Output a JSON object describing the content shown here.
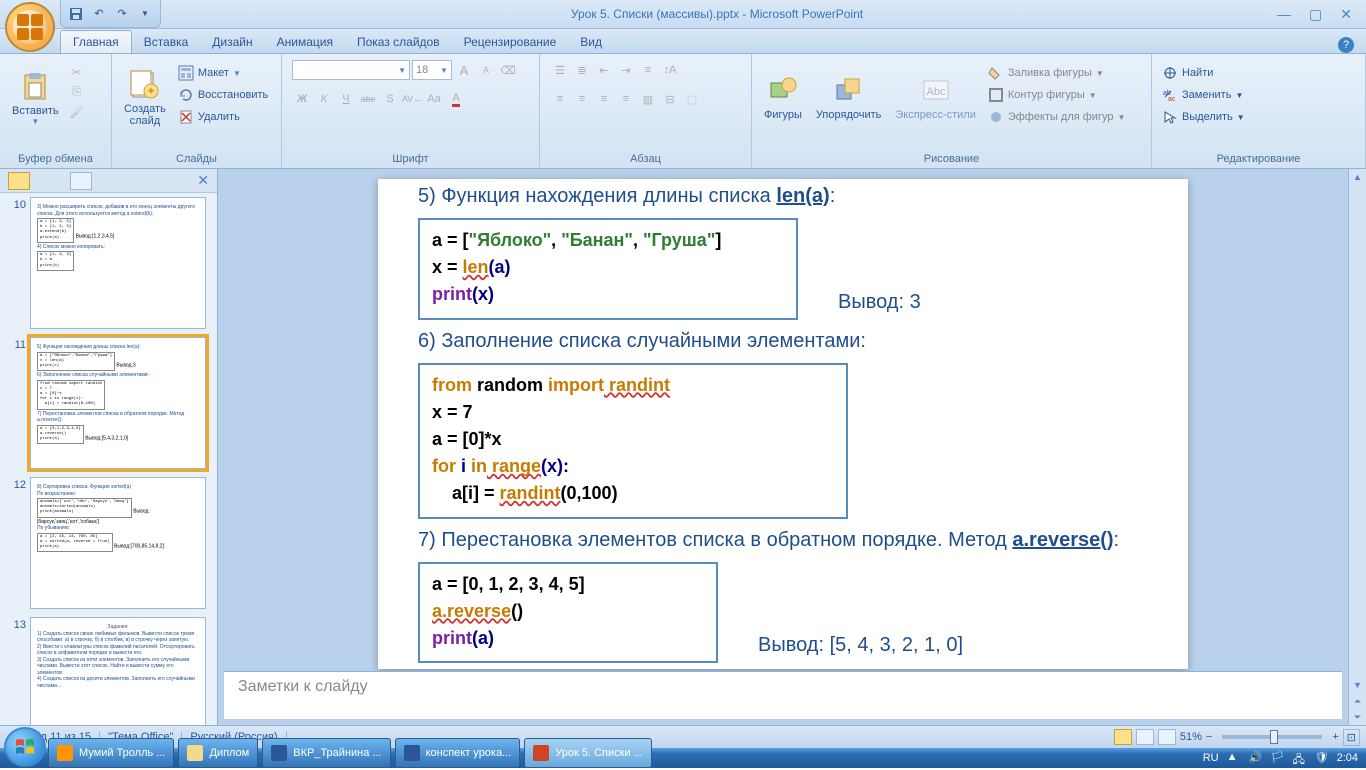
{
  "title": "Урок 5. Списки (массивы).pptx - Microsoft PowerPoint",
  "tabs": [
    "Главная",
    "Вставка",
    "Дизайн",
    "Анимация",
    "Показ слайдов",
    "Рецензирование",
    "Вид"
  ],
  "active_tab": 0,
  "ribbon": {
    "clipboard": {
      "label": "Буфер обмена",
      "paste": "Вставить"
    },
    "slides": {
      "label": "Слайды",
      "new": "Создать\nслайд",
      "layout": "Макет",
      "reset": "Восстановить",
      "delete": "Удалить"
    },
    "font": {
      "label": "Шрифт",
      "size": "18",
      "bold": "Ж",
      "italic": "К",
      "underline": "Ч",
      "strike": "abc",
      "shadow": "S",
      "spacing": "AV",
      "case": "Aa",
      "color": "A"
    },
    "paragraph": {
      "label": "Абзац"
    },
    "drawing": {
      "label": "Рисование",
      "shapes": "Фигуры",
      "arrange": "Упорядочить",
      "styles": "Экспресс-стили",
      "fill": "Заливка фигуры",
      "outline": "Контур фигуры",
      "effects": "Эффекты для фигур"
    },
    "editing": {
      "label": "Редактирование",
      "find": "Найти",
      "replace": "Заменить",
      "select": "Выделить"
    }
  },
  "slide": {
    "h5": "5) Функция нахождения длины списка ",
    "h5b": "len(a)",
    "code5": {
      "l1a": "a = [",
      "l1b": "\"Яблоко\"",
      "l1c": ", ",
      "l1d": "\"Банан\"",
      "l1e": ", ",
      "l1f": "\"Груша\"",
      "l1g": "]",
      "l2a": "x = ",
      "l2b": "len",
      "l2c": "(a)",
      "l3a": "print",
      "l3b": "(x)"
    },
    "out5": "Вывод: 3",
    "h6": "6) Заполнение списка случайными элементами:",
    "code6": {
      "l1a": "from",
      "l1b": " random ",
      "l1c": "import",
      "l1d": " randint",
      "l2": "x = 7",
      "l3": "a = [0]*x",
      "l4a": "for",
      "l4b": " i ",
      "l4c": "in",
      "l4d": " range",
      "l4e": "(x):",
      "l5a": "    a[i] = ",
      "l5b": "randint",
      "l5c": "(0,100)"
    },
    "h7": "7) Перестановка  элементов списка в обратном порядке. Метод ",
    "h7b": "a.reverse()",
    "code7": {
      "l1": "a = [0, 1, 2, 3, 4, 5]",
      "l2a": "a.reverse",
      "l2b": "()",
      "l3a": "print",
      "l3b": "(a)"
    },
    "out7": "Вывод: [5, 4, 3, 2, 1, 0]"
  },
  "notes_placeholder": "Заметки к слайду",
  "thumb_numbers": [
    "10",
    "11",
    "12",
    "13"
  ],
  "status": {
    "slide": "Слайд 11 из 15",
    "theme": "\"Тема Office\"",
    "lang": "Русский (Россия)",
    "zoom": "51%"
  },
  "taskbar": {
    "items": [
      "Мумий Тролль ...",
      "Диплом",
      "ВКР_Трайнина ...",
      "конспект урока...",
      "Урок 5. Списки ..."
    ],
    "lang": "RU",
    "time": "2:04"
  }
}
